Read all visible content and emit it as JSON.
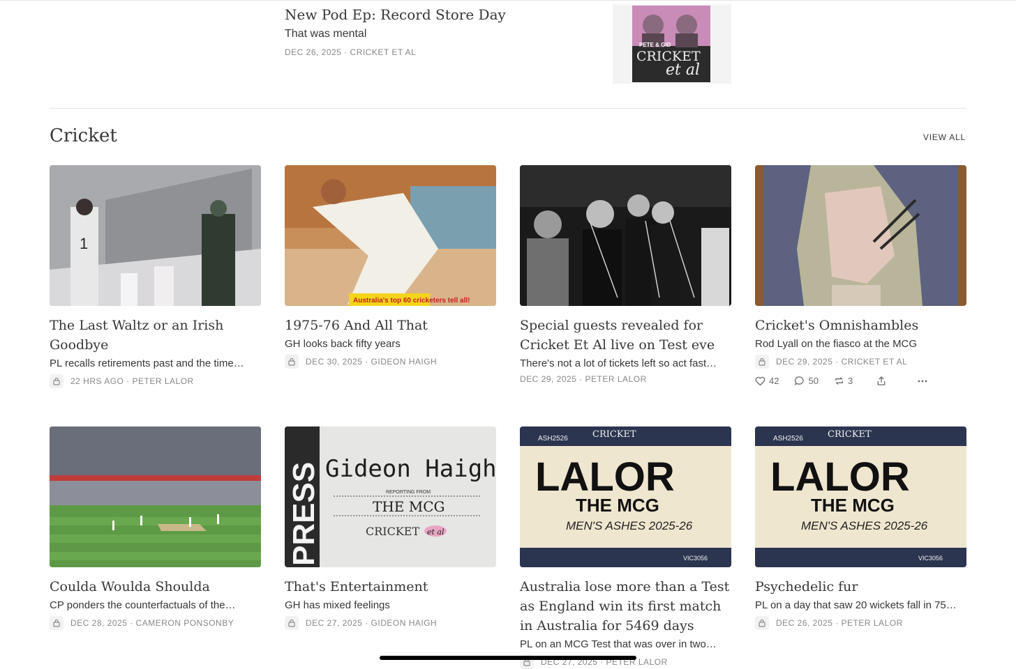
{
  "top_post": {
    "title": "New Pod Ep: Record Store Day",
    "subtitle": "That was mental",
    "meta": "DEC 26, 2025 · CRICKET ET AL",
    "thumb_text_1": "PETE & GID",
    "thumb_text_2": "CRICKET",
    "thumb_text_3": "et al"
  },
  "section": {
    "title": "Cricket",
    "view_all": "VIEW ALL"
  },
  "cards": [
    {
      "title": "The Last Waltz or an Irish Goodbye",
      "subtitle": "PL recalls retirements past and the time…",
      "meta": "22 HRS AGO · PETER LALOR",
      "locked": true
    },
    {
      "title": "1975-76 And All That",
      "subtitle": "GH looks back fifty years",
      "meta": "DEC 30, 2025 · GIDEON HAIGH",
      "locked": true,
      "img_caption": "Australia's top 60 cricketers tell all!"
    },
    {
      "title": "Special guests revealed for Cricket Et Al live on Test eve",
      "subtitle": "There's not a lot of tickets left so act fast…",
      "meta": "DEC 29, 2025 · PETER LALOR",
      "locked": false
    },
    {
      "title": "Cricket's Omnishambles",
      "subtitle": "Rod Lyall on the fiasco at the MCG",
      "meta": "DEC 29, 2025 · CRICKET ET AL",
      "locked": true,
      "likes": "42",
      "comments": "50",
      "restacks": "3"
    },
    {
      "title": "Coulda Woulda Shoulda",
      "subtitle": "CP ponders the counterfactuals of the…",
      "meta": "DEC 28, 2025 · CAMERON PONSONBY",
      "locked": true
    },
    {
      "title": "That's Entertainment",
      "subtitle": "GH has mixed feelings",
      "meta": "DEC 27, 2025 · GIDEON HAIGH",
      "locked": true,
      "img": {
        "side": "PRESS",
        "name": "Gideon Haigh",
        "small": "REPORTING FROM",
        "place": "THE MCG",
        "brand": "CRICKET",
        "brand2": "et al"
      }
    },
    {
      "title": "Australia lose more than a Test as England win its first match in Australia for 5469 days",
      "subtitle": "PL on an MCG Test that was over in two…",
      "meta": "DEC 27, 2025 · PETER LALOR",
      "locked": true,
      "img": {
        "code": "ASH2526",
        "brand": "CRICKET",
        "name": "LALOR",
        "place": "THE MCG",
        "series": "MEN'S ASHES 2025-26",
        "ref": "VIC3056"
      }
    },
    {
      "title": "Psychedelic fur",
      "subtitle": "PL on a day that saw 20 wickets fall in 75…",
      "meta": "DEC 26, 2025 · PETER LALOR",
      "locked": true,
      "img": {
        "code": "ASH2526",
        "brand": "CRICKET",
        "name": "LALOR",
        "place": "THE MCG",
        "series": "MEN'S ASHES 2025-26",
        "ref": "VIC3056"
      }
    }
  ]
}
